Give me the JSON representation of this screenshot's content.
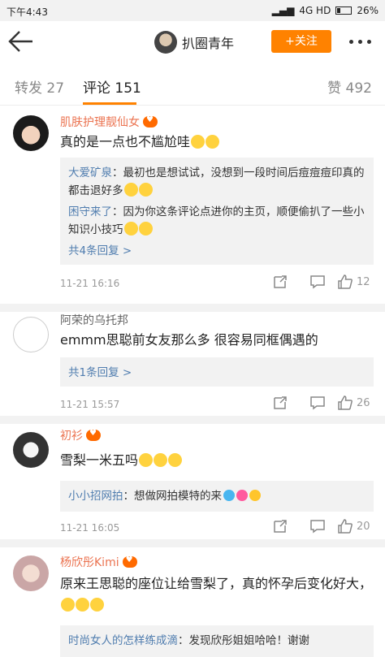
{
  "status": {
    "time": "下午4:43",
    "network": "4G HD",
    "battery": "26%"
  },
  "header": {
    "title": "扒圈青年",
    "follow_label": "+关注"
  },
  "tabs": {
    "repost": "转发 27",
    "comment": "评论 151",
    "like": "赞 492"
  },
  "comments": [
    {
      "user": "肌肤护理靓仙女",
      "text": "真的是一点也不尴尬哇",
      "replies": [
        {
          "user": "大爱矿泉",
          "text": "：最初也是想试试，没想到一段时间后痘痘痘印真的都击退好多"
        },
        {
          "user": "困守来了",
          "text": "：因为你这条评论点进你的主页，顺便偷扒了一些小知识小技巧"
        }
      ],
      "more": "共4条回复 >",
      "time": "11-21 16:16",
      "likes": "12"
    },
    {
      "user": "阿荣的乌托邦",
      "text": "emmm思聪前女友那么多 很容易同框偶遇的",
      "more": "共1条回复 >",
      "time": "11-21 15:57",
      "likes": "26"
    },
    {
      "user": "初衫",
      "text": "雪梨一米五吗",
      "replies": [
        {
          "user": "小小招网拍",
          "text": "：想做网拍模特的来"
        }
      ],
      "time": "11-21 16:05",
      "likes": "20"
    },
    {
      "user": "杨欣彤Kimi",
      "text": "原来王思聪的座位让给雪梨了，真的怀孕后变化好大，",
      "replies": [
        {
          "user": "时尚女人的怎样练成滴",
          "text": "：发现欣彤姐姐哈哈！谢谢"
        }
      ]
    }
  ],
  "colors": {
    "accent": "#ff8200",
    "username": "#eb7350",
    "link": "#507daf"
  }
}
